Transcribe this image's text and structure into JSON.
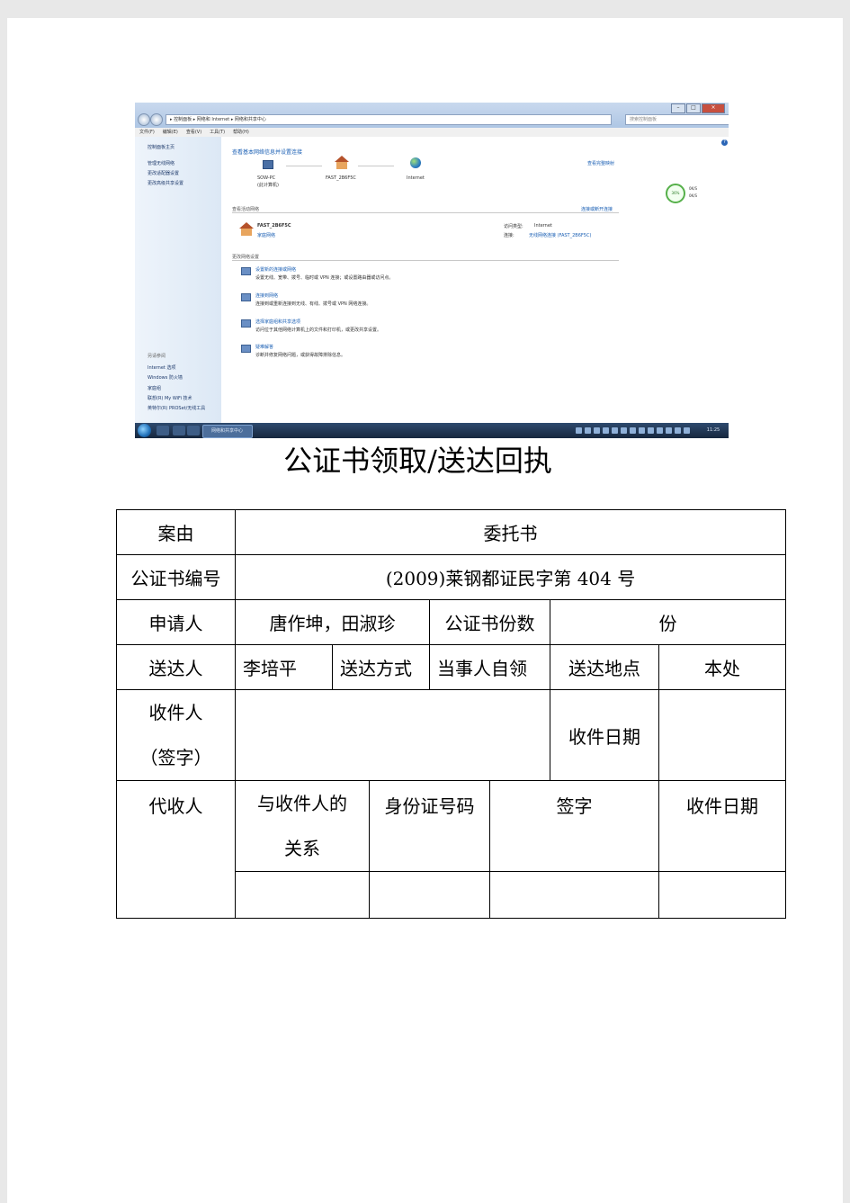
{
  "screenshot": {
    "address": "▸ 控制面板 ▸ 网络和 Internet ▸ 网络和共享中心",
    "search_placeholder": "搜索控制面板",
    "menu": [
      "文件(F)",
      "编辑(E)",
      "查看(V)",
      "工具(T)",
      "帮助(H)"
    ],
    "sidebar_top": [
      "控制面板主页",
      "管理无线网络",
      "更改适配器设置",
      "更改高级共享设置"
    ],
    "see_also_title": "另请参阅",
    "sidebar_bottom": [
      "Internet 选项",
      "Windows 防火墙",
      "家庭组",
      "联想(R) My WiFi 技术",
      "英特尔(R) PROSet/无线工具"
    ],
    "heading": "查看基本网络信息并设置连接",
    "view_full_map": "查看完整映射",
    "node_pc": "SOW-PC",
    "node_pc_sub": "(此计算机)",
    "node_router": "FAST_2B6F5C",
    "node_internet": "Internet",
    "active_networks_label": "查看活动网络",
    "connect_disconnect": "连接或断开连接",
    "network_name": "FAST_2B6F5C",
    "network_type": "家庭网络",
    "access_type_label": "访问类型:",
    "access_type_value": "Internet",
    "connection_label": "连接:",
    "connection_value": "无线网络连接 (FAST_2B6F5C)",
    "change_settings_label": "更改网络设置",
    "tasks": [
      {
        "title": "设置新的连接或网络",
        "desc": "设置无线、宽带、拨号、临时或 VPN 连接；或设置路由器或访问点。"
      },
      {
        "title": "连接到网络",
        "desc": "连接到或重新连接到无线、有线、拨号或 VPN 网络连接。"
      },
      {
        "title": "选择家庭组和共享选项",
        "desc": "访问位于其他网络计算机上的文件和打印机，或更改共享设置。"
      },
      {
        "title": "疑难解答",
        "desc": "诊断并修复网络问题，或获得故障排除信息。"
      }
    ],
    "gauge_percent": "36%",
    "speed_up": "0K/S",
    "speed_down": "0K/S",
    "taskbar_task": "网络和共享中心",
    "clock": "11:25"
  },
  "document": {
    "title": "公证书领取/送达回执",
    "rows": {
      "case_label": "案由",
      "case_value": "委托书",
      "cert_no_label": "公证书编号",
      "cert_no_value": "(2009)莱钢都证民字第 404 号",
      "applicant_label": "申请人",
      "applicant_value": "唐作坤，田淑珍",
      "copies_label": "公证书份数",
      "copies_value": "份",
      "deliverer_label": "送达人",
      "deliverer_value": "李培平",
      "method_label": "送达方式",
      "method_value": "当事人自领",
      "place_label": "送达地点",
      "place_value": "本处",
      "recipient_label_1": "收件人",
      "recipient_label_2": "（签字）",
      "recipient_date_label": "收件日期",
      "proxy_label": "代收人",
      "relation_label_1": "与收件人的",
      "relation_label_2": "关系",
      "id_label": "身份证号码",
      "sign_label": "签字",
      "proxy_date_label": "收件日期"
    }
  }
}
